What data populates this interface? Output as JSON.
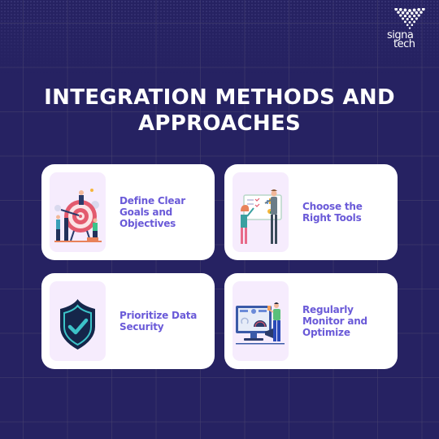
{
  "brand": {
    "logo_line1": "signa",
    "logo_line2": "tech",
    "icon": "dotted-wave-logo-icon"
  },
  "header": {
    "title_line1": "INTEGRATION METHODS AND",
    "title_line2": "APPROACHES"
  },
  "colors": {
    "background": "#262262",
    "card": "#ffffff",
    "panel": "#f6ecfd",
    "label": "#6a5ad8",
    "shield_dark": "#15264a",
    "shield_accent": "#3cc3c8"
  },
  "cards": [
    {
      "label": "Define Clear Goals and Objectives",
      "illustration": "target-goal-illustration"
    },
    {
      "label": "Choose the Right Tools",
      "illustration": "whiteboard-planning-illustration"
    },
    {
      "label": "Prioritize Data Security",
      "illustration": "shield-check-illustration"
    },
    {
      "label": "Regularly Monitor and Optimize",
      "illustration": "monitor-dashboard-illustration"
    }
  ]
}
